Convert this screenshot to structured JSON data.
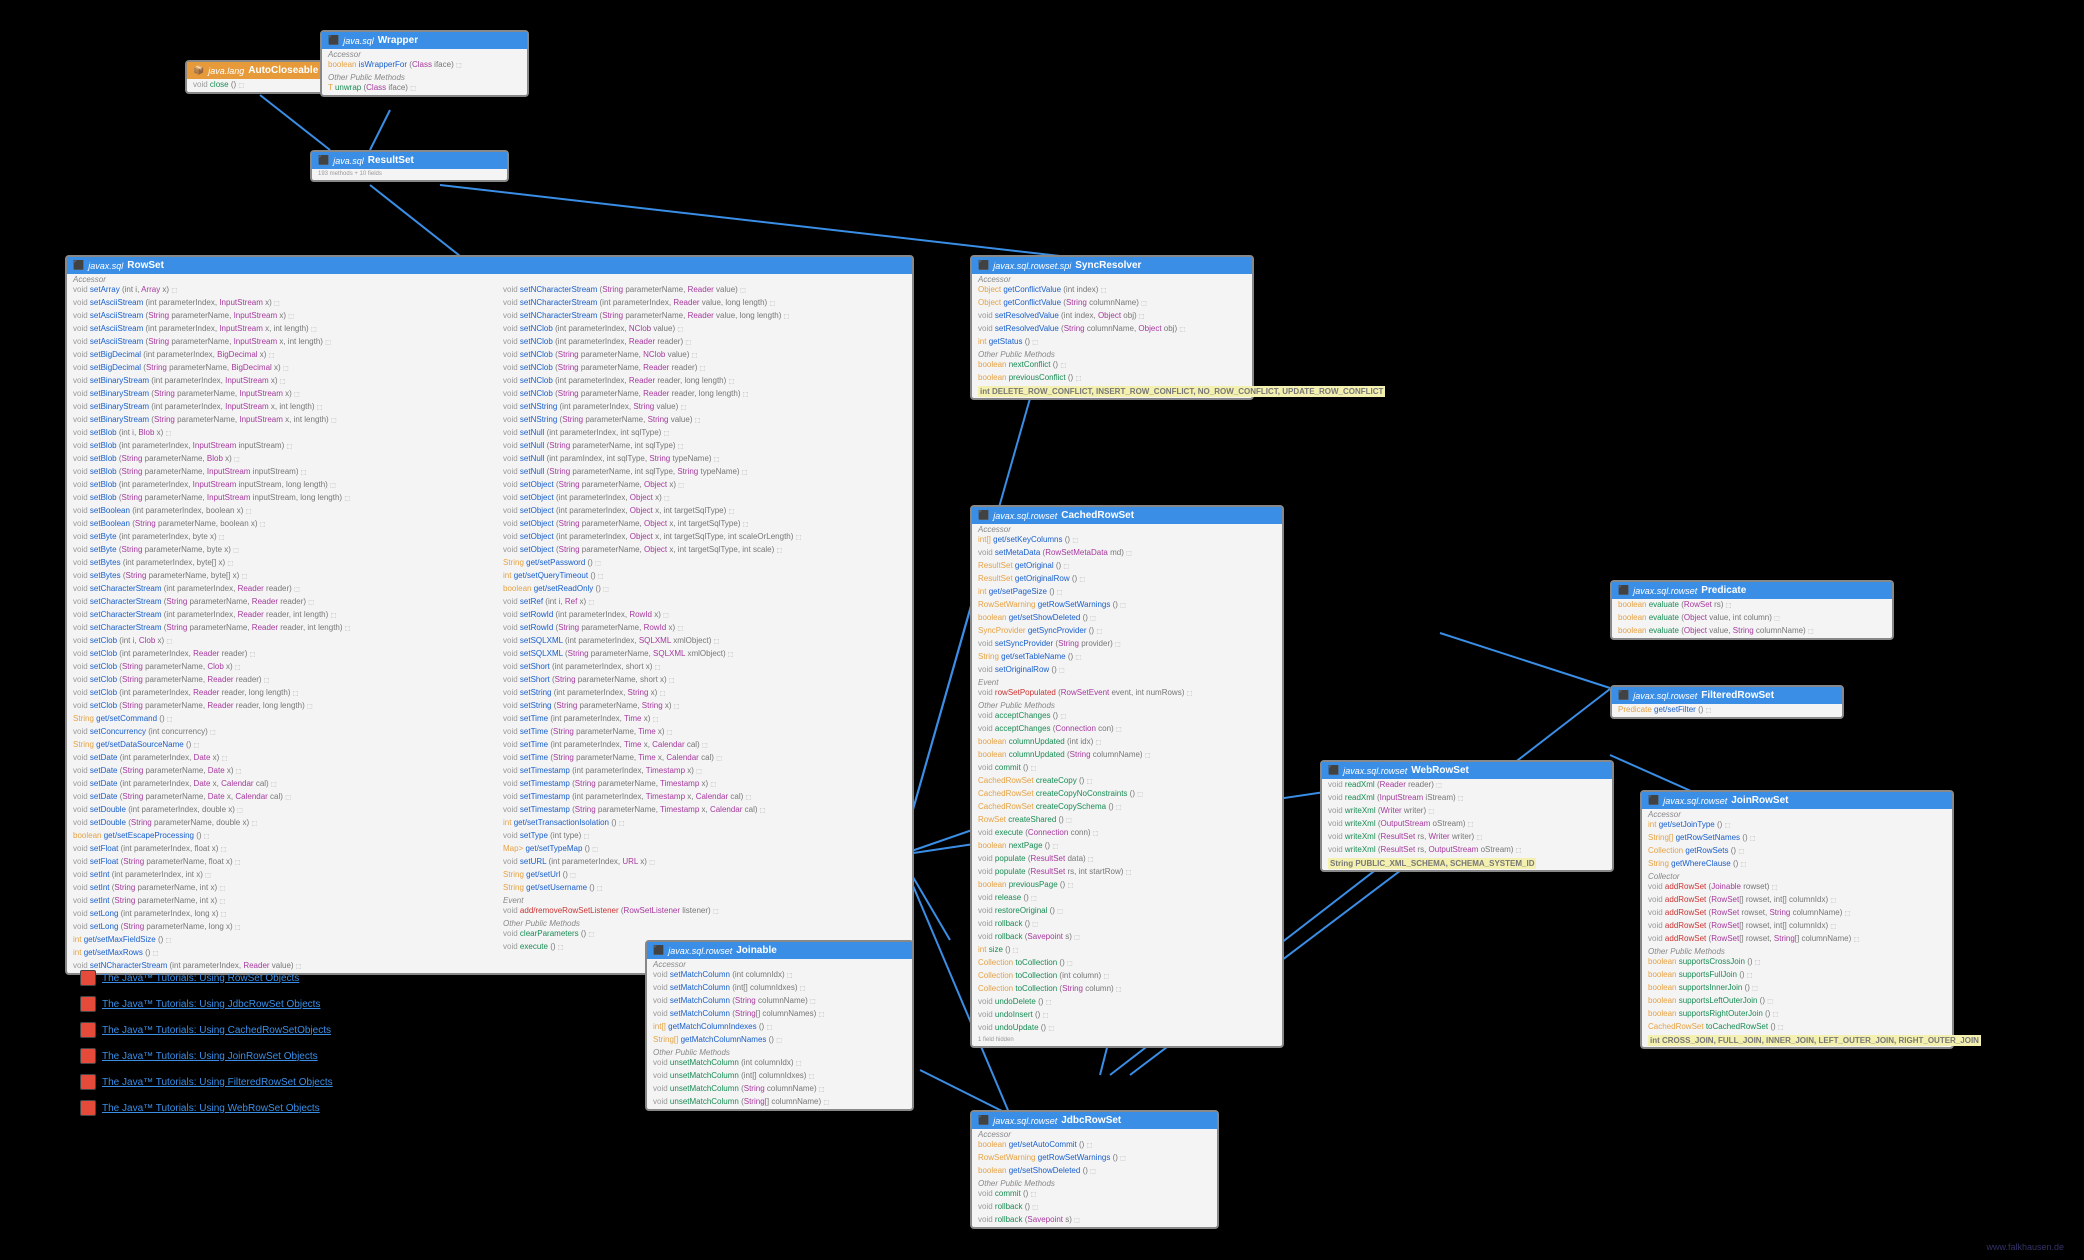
{
  "footer": "www.falkhausen.de",
  "tutorials": [
    "The Java™ Tutorials: Using RowSet Objects",
    "The Java™ Tutorials: Using JdbcRowSet Objects",
    "The Java™ Tutorials: Using CachedRowSetObjects",
    "The Java™ Tutorials: Using JoinRowSet Objects",
    "The Java™ Tutorials: Using FilteredRowSet Objects",
    "The Java™ Tutorials: Using WebRowSet Objects"
  ],
  "autoCloseable": {
    "pkg": "java.lang",
    "name": "AutoCloseable",
    "m": [
      [
        "void",
        "close",
        "()"
      ]
    ]
  },
  "wrapper": {
    "pkg": "java.sql",
    "name": "Wrapper",
    "accessor": [
      [
        "boolean",
        "isWrapperFor",
        "(Class<?> iface)"
      ]
    ],
    "other": [
      [
        "<T> T",
        "unwrap",
        "(Class<T> iface)"
      ]
    ]
  },
  "resultSet": {
    "pkg": "java.sql",
    "name": "ResultSet",
    "sub": "193 methods + 10 fields"
  },
  "rowset": {
    "pkg": "javax.sql",
    "name": "RowSet",
    "accL": [
      [
        "void",
        "setArray",
        "(int i, Array x)"
      ],
      [
        "void",
        "setAsciiStream",
        "(int parameterIndex, InputStream x)"
      ],
      [
        "void",
        "setAsciiStream",
        "(String parameterName, InputStream x)"
      ],
      [
        "void",
        "setAsciiStream",
        "(int parameterIndex, InputStream x, int length)"
      ],
      [
        "void",
        "setAsciiStream",
        "(String parameterName, InputStream x, int length)"
      ],
      [
        "void",
        "setBigDecimal",
        "(int parameterIndex, BigDecimal x)"
      ],
      [
        "void",
        "setBigDecimal",
        "(String parameterName, BigDecimal x)"
      ],
      [
        "void",
        "setBinaryStream",
        "(int parameterIndex, InputStream x)"
      ],
      [
        "void",
        "setBinaryStream",
        "(String parameterName, InputStream x)"
      ],
      [
        "void",
        "setBinaryStream",
        "(int parameterIndex, InputStream x, int length)"
      ],
      [
        "void",
        "setBinaryStream",
        "(String parameterName, InputStream x, int length)"
      ],
      [
        "void",
        "setBlob",
        "(int i, Blob x)"
      ],
      [
        "void",
        "setBlob",
        "(int parameterIndex, InputStream inputStream)"
      ],
      [
        "void",
        "setBlob",
        "(String parameterName, Blob x)"
      ],
      [
        "void",
        "setBlob",
        "(String parameterName, InputStream inputStream)"
      ],
      [
        "void",
        "setBlob",
        "(int parameterIndex, InputStream inputStream, long length)"
      ],
      [
        "void",
        "setBlob",
        "(String parameterName, InputStream inputStream, long length)"
      ],
      [
        "void",
        "setBoolean",
        "(int parameterIndex, boolean x)"
      ],
      [
        "void",
        "setBoolean",
        "(String parameterName, boolean x)"
      ],
      [
        "void",
        "setByte",
        "(int parameterIndex, byte x)"
      ],
      [
        "void",
        "setByte",
        "(String parameterName, byte x)"
      ],
      [
        "void",
        "setBytes",
        "(int parameterIndex, byte[] x)"
      ],
      [
        "void",
        "setBytes",
        "(String parameterName, byte[] x)"
      ],
      [
        "void",
        "setCharacterStream",
        "(int parameterIndex, Reader reader)"
      ],
      [
        "void",
        "setCharacterStream",
        "(String parameterName, Reader reader)"
      ],
      [
        "void",
        "setCharacterStream",
        "(int parameterIndex, Reader reader, int length)"
      ],
      [
        "void",
        "setCharacterStream",
        "(String parameterName, Reader reader, int length)"
      ],
      [
        "void",
        "setClob",
        "(int i, Clob x)"
      ],
      [
        "void",
        "setClob",
        "(int parameterIndex, Reader reader)"
      ],
      [
        "void",
        "setClob",
        "(String parameterName, Clob x)"
      ],
      [
        "void",
        "setClob",
        "(String parameterName, Reader reader)"
      ],
      [
        "void",
        "setClob",
        "(int parameterIndex, Reader reader, long length)"
      ],
      [
        "void",
        "setClob",
        "(String parameterName, Reader reader, long length)"
      ],
      [
        "String",
        "get/setCommand",
        "()"
      ],
      [
        "void",
        "setConcurrency",
        "(int concurrency)"
      ],
      [
        "String",
        "get/setDataSourceName",
        "()"
      ],
      [
        "void",
        "setDate",
        "(int parameterIndex, Date x)"
      ],
      [
        "void",
        "setDate",
        "(String parameterName, Date x)"
      ],
      [
        "void",
        "setDate",
        "(int parameterIndex, Date x, Calendar cal)"
      ],
      [
        "void",
        "setDate",
        "(String parameterName, Date x, Calendar cal)"
      ],
      [
        "void",
        "setDouble",
        "(int parameterIndex, double x)"
      ],
      [
        "void",
        "setDouble",
        "(String parameterName, double x)"
      ],
      [
        "boolean",
        "get/setEscapeProcessing",
        "()"
      ],
      [
        "void",
        "setFloat",
        "(int parameterIndex, float x)"
      ],
      [
        "void",
        "setFloat",
        "(String parameterName, float x)"
      ],
      [
        "void",
        "setInt",
        "(int parameterIndex, int x)"
      ],
      [
        "void",
        "setInt",
        "(String parameterName, int x)"
      ],
      [
        "void",
        "setInt",
        "(String parameterName, int x)"
      ],
      [
        "void",
        "setLong",
        "(int parameterIndex, long x)"
      ],
      [
        "void",
        "setLong",
        "(String parameterName, long x)"
      ],
      [
        "int",
        "get/setMaxFieldSize",
        "()"
      ],
      [
        "int",
        "get/setMaxRows",
        "()"
      ],
      [
        "void",
        "setNCharacterStream",
        "(int parameterIndex, Reader value)"
      ]
    ],
    "accR": [
      [
        "void",
        "setNCharacterStream",
        "(String parameterName, Reader value)"
      ],
      [
        "void",
        "setNCharacterStream",
        "(int parameterIndex, Reader value, long length)"
      ],
      [
        "void",
        "setNCharacterStream",
        "(String parameterName, Reader value, long length)"
      ],
      [
        "void",
        "setNClob",
        "(int parameterIndex, NClob value)"
      ],
      [
        "void",
        "setNClob",
        "(int parameterIndex, Reader reader)"
      ],
      [
        "void",
        "setNClob",
        "(String parameterName, NClob value)"
      ],
      [
        "void",
        "setNClob",
        "(String parameterName, Reader reader)"
      ],
      [
        "void",
        "setNClob",
        "(int parameterIndex, Reader reader, long length)"
      ],
      [
        "void",
        "setNClob",
        "(String parameterName, Reader reader, long length)"
      ],
      [
        "void",
        "setNString",
        "(int parameterIndex, String value)"
      ],
      [
        "void",
        "setNString",
        "(String parameterName, String value)"
      ],
      [
        "void",
        "setNull",
        "(int parameterIndex, int sqlType)"
      ],
      [
        "void",
        "setNull",
        "(String parameterName, int sqlType)"
      ],
      [
        "void",
        "setNull",
        "(int paramIndex, int sqlType, String typeName)"
      ],
      [
        "void",
        "setNull",
        "(String parameterName, int sqlType, String typeName)"
      ],
      [
        "void",
        "setObject",
        "(String parameterName, Object x)"
      ],
      [
        "void",
        "setObject",
        "(int parameterIndex, Object x)"
      ],
      [
        "void",
        "setObject",
        "(int parameterIndex, Object x, int targetSqlType)"
      ],
      [
        "void",
        "setObject",
        "(String parameterName, Object x, int targetSqlType)"
      ],
      [
        "void",
        "setObject",
        "(int parameterIndex, Object x, int targetSqlType, int scaleOrLength)"
      ],
      [
        "void",
        "setObject",
        "(String parameterName, Object x, int targetSqlType, int scale)"
      ],
      [
        "String",
        "get/setPassword",
        "()"
      ],
      [
        "int",
        "get/setQueryTimeout",
        "()"
      ],
      [
        "boolean",
        "get/setReadOnly",
        "()"
      ],
      [
        "void",
        "setRef",
        "(int i, Ref x)"
      ],
      [
        "void",
        "setRowId",
        "(int parameterIndex, RowId x)"
      ],
      [
        "void",
        "setRowId",
        "(String parameterName, RowId x)"
      ],
      [
        "void",
        "setSQLXML",
        "(int parameterIndex, SQLXML xmlObject)"
      ],
      [
        "void",
        "setSQLXML",
        "(String parameterName, SQLXML xmlObject)"
      ],
      [
        "void",
        "setShort",
        "(int parameterIndex, short x)"
      ],
      [
        "void",
        "setShort",
        "(String parameterName, short x)"
      ],
      [
        "void",
        "setString",
        "(int parameterIndex, String x)"
      ],
      [
        "void",
        "setString",
        "(String parameterName, String x)"
      ],
      [
        "void",
        "setTime",
        "(int parameterIndex, Time x)"
      ],
      [
        "void",
        "setTime",
        "(String parameterName, Time x)"
      ],
      [
        "void",
        "setTime",
        "(int parameterIndex, Time x, Calendar cal)"
      ],
      [
        "void",
        "setTime",
        "(String parameterName, Time x, Calendar cal)"
      ],
      [
        "void",
        "setTimestamp",
        "(int parameterIndex, Timestamp x)"
      ],
      [
        "void",
        "setTimestamp",
        "(String parameterName, Timestamp x)"
      ],
      [
        "void",
        "setTimestamp",
        "(int parameterIndex, Timestamp x, Calendar cal)"
      ],
      [
        "void",
        "setTimestamp",
        "(String parameterName, Timestamp x, Calendar cal)"
      ],
      [
        "int",
        "get/setTransactionIsolation",
        "()"
      ],
      [
        "void",
        "setType",
        "(int type)"
      ],
      [
        "Map<String, Class<?>>",
        "get/setTypeMap",
        "()"
      ],
      [
        "void",
        "setURL",
        "(int parameterIndex, URL x)"
      ],
      [
        "String",
        "get/setUrl",
        "()"
      ],
      [
        "String",
        "get/setUsername",
        "()"
      ]
    ],
    "event": [
      [
        "void",
        "add/removeRowSetListener",
        "(RowSetListener listener)"
      ]
    ],
    "other": [
      [
        "void",
        "clearParameters",
        "()"
      ],
      [
        "void",
        "execute",
        "()"
      ]
    ]
  },
  "syncResolver": {
    "pkg": "javax.sql.rowset.spi",
    "name": "SyncResolver",
    "acc": [
      [
        "Object",
        "getConflictValue",
        "(int index)"
      ],
      [
        "Object",
        "getConflictValue",
        "(String columnName)"
      ],
      [
        "void",
        "setResolvedValue",
        "(int index, Object obj)"
      ],
      [
        "void",
        "setResolvedValue",
        "(String columnName, Object obj)"
      ],
      [
        "int",
        "getStatus",
        "()"
      ]
    ],
    "other": [
      [
        "boolean",
        "nextConflict",
        "()"
      ],
      [
        "boolean",
        "previousConflict",
        "()"
      ]
    ],
    "consts": "int DELETE_ROW_CONFLICT, INSERT_ROW_CONFLICT, NO_ROW_CONFLICT, UPDATE_ROW_CONFLICT"
  },
  "cachedRowSet": {
    "pkg": "javax.sql.rowset",
    "name": "CachedRowSet",
    "acc": [
      [
        "int[]",
        "get/setKeyColumns",
        "()"
      ],
      [
        "void",
        "setMetaData",
        "(RowSetMetaData md)"
      ],
      [
        "ResultSet",
        "getOriginal",
        "()"
      ],
      [
        "ResultSet",
        "getOriginalRow",
        "()"
      ],
      [
        "int",
        "get/setPageSize",
        "()"
      ],
      [
        "RowSetWarning",
        "getRowSetWarnings",
        "()"
      ],
      [
        "boolean",
        "get/setShowDeleted",
        "()"
      ],
      [
        "SyncProvider",
        "getSyncProvider",
        "()"
      ],
      [
        "void",
        "setSyncProvider",
        "(String provider)"
      ],
      [
        "String",
        "get/setTableName",
        "()"
      ],
      [
        "void",
        "setOriginalRow",
        "()"
      ]
    ],
    "event": [
      [
        "void",
        "rowSetPopulated",
        "(RowSetEvent event, int numRows)"
      ]
    ],
    "other": [
      [
        "void",
        "acceptChanges",
        "()"
      ],
      [
        "void",
        "acceptChanges",
        "(Connection con)"
      ],
      [
        "boolean",
        "columnUpdated",
        "(int idx)"
      ],
      [
        "boolean",
        "columnUpdated",
        "(String columnName)"
      ],
      [
        "void",
        "commit",
        "()"
      ],
      [
        "CachedRowSet",
        "createCopy",
        "()"
      ],
      [
        "CachedRowSet",
        "createCopyNoConstraints",
        "()"
      ],
      [
        "CachedRowSet",
        "createCopySchema",
        "()"
      ],
      [
        "RowSet",
        "createShared",
        "()"
      ],
      [
        "void",
        "execute",
        "(Connection conn)"
      ],
      [
        "boolean",
        "nextPage",
        "()"
      ],
      [
        "void",
        "populate",
        "(ResultSet data)"
      ],
      [
        "void",
        "populate",
        "(ResultSet rs, int startRow)"
      ],
      [
        "boolean",
        "previousPage",
        "()"
      ],
      [
        "void",
        "release",
        "()"
      ],
      [
        "void",
        "restoreOriginal",
        "()"
      ],
      [
        "void",
        "rollback",
        "()"
      ],
      [
        "void",
        "rollback",
        "(Savepoint s)"
      ],
      [
        "int",
        "size",
        "()"
      ],
      [
        "Collection<?>",
        "toCollection",
        "()"
      ],
      [
        "Collection<?>",
        "toCollection",
        "(int column)"
      ],
      [
        "Collection<?>",
        "toCollection",
        "(String column)"
      ],
      [
        "void",
        "undoDelete",
        "()"
      ],
      [
        "void",
        "undoInsert",
        "()"
      ],
      [
        "void",
        "undoUpdate",
        "()"
      ]
    ],
    "sub": "1 field hidden"
  },
  "joinable": {
    "pkg": "javax.sql.rowset",
    "name": "Joinable",
    "acc": [
      [
        "void",
        "setMatchColumn",
        "(int columnIdx)"
      ],
      [
        "void",
        "setMatchColumn",
        "(int[] columnIdxes)"
      ],
      [
        "void",
        "setMatchColumn",
        "(String columnName)"
      ],
      [
        "void",
        "setMatchColumn",
        "(String[] columnNames)"
      ],
      [
        "int[]",
        "getMatchColumnIndexes",
        "()"
      ],
      [
        "String[]",
        "getMatchColumnNames",
        "()"
      ]
    ],
    "other": [
      [
        "void",
        "unsetMatchColumn",
        "(int columnIdx)"
      ],
      [
        "void",
        "unsetMatchColumn",
        "(int[] columnIdxes)"
      ],
      [
        "void",
        "unsetMatchColumn",
        "(String columnName)"
      ],
      [
        "void",
        "unsetMatchColumn",
        "(String[] columnName)"
      ]
    ]
  },
  "jdbcRowSet": {
    "pkg": "javax.sql.rowset",
    "name": "JdbcRowSet",
    "acc": [
      [
        "boolean",
        "get/setAutoCommit",
        "()"
      ],
      [
        "RowSetWarning",
        "getRowSetWarnings",
        "()"
      ],
      [
        "boolean",
        "get/setShowDeleted",
        "()"
      ]
    ],
    "other": [
      [
        "void",
        "commit",
        "()"
      ],
      [
        "void",
        "rollback",
        "()"
      ],
      [
        "void",
        "rollback",
        "(Savepoint s)"
      ]
    ]
  },
  "webRowSet": {
    "pkg": "javax.sql.rowset",
    "name": "WebRowSet",
    "m": [
      [
        "void",
        "readXml",
        "(Reader reader)"
      ],
      [
        "void",
        "readXml",
        "(InputStream iStream)"
      ],
      [
        "void",
        "writeXml",
        "(Writer writer)"
      ],
      [
        "void",
        "writeXml",
        "(OutputStream oStream)"
      ],
      [
        "void",
        "writeXml",
        "(ResultSet rs, Writer writer)"
      ],
      [
        "void",
        "writeXml",
        "(ResultSet rs, OutputStream oStream)"
      ]
    ],
    "consts": "String PUBLIC_XML_SCHEMA, SCHEMA_SYSTEM_ID"
  },
  "predicate": {
    "pkg": "javax.sql.rowset",
    "name": "Predicate",
    "m": [
      [
        "boolean",
        "evaluate",
        "(RowSet rs)"
      ],
      [
        "boolean",
        "evaluate",
        "(Object value, int column)"
      ],
      [
        "boolean",
        "evaluate",
        "(Object value, String columnName)"
      ]
    ]
  },
  "filteredRowSet": {
    "pkg": "javax.sql.rowset",
    "name": "FilteredRowSet",
    "m": [
      [
        "Predicate",
        "get/setFilter",
        "()"
      ]
    ]
  },
  "joinRowSet": {
    "pkg": "javax.sql.rowset",
    "name": "JoinRowSet",
    "acc": [
      [
        "int",
        "get/setJoinType",
        "()"
      ],
      [
        "String[]",
        "getRowSetNames",
        "()"
      ],
      [
        "Collection<?>",
        "getRowSets",
        "()"
      ],
      [
        "String",
        "getWhereClause",
        "()"
      ]
    ],
    "coll": [
      [
        "void",
        "addRowSet",
        "(Joinable rowset)"
      ],
      [
        "void",
        "addRowSet",
        "(RowSet[] rowset, int[] columnIdx)"
      ],
      [
        "void",
        "addRowSet",
        "(RowSet rowset, String columnName)"
      ],
      [
        "void",
        "addRowSet",
        "(RowSet[] rowset, int[] columnIdx)"
      ],
      [
        "void",
        "addRowSet",
        "(RowSet[] rowset, String[] columnName)"
      ]
    ],
    "other": [
      [
        "boolean",
        "supportsCrossJoin",
        "()"
      ],
      [
        "boolean",
        "supportsFullJoin",
        "()"
      ],
      [
        "boolean",
        "supportsInnerJoin",
        "()"
      ],
      [
        "boolean",
        "supportsLeftOuterJoin",
        "()"
      ],
      [
        "boolean",
        "supportsRightOuterJoin",
        "()"
      ],
      [
        "CachedRowSet",
        "toCachedRowSet",
        "()"
      ]
    ],
    "consts": "int CROSS_JOIN, FULL_JOIN, INNER_JOIN, LEFT_OUTER_JOIN, RIGHT_OUTER_JOIN"
  }
}
